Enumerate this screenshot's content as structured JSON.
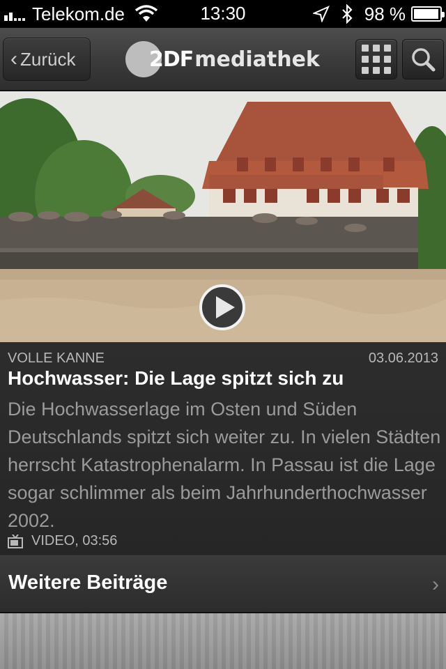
{
  "status_bar": {
    "carrier": "Telekom.de",
    "time": "13:30",
    "battery_percent": "98 %",
    "battery_level": 0.98
  },
  "nav": {
    "back_label": "Zurück",
    "logo_mark": "2DF",
    "logo_text": "mediathek",
    "icons": {
      "grid": "grid-icon",
      "search": "search-icon"
    }
  },
  "hero": {
    "icon": "play-icon"
  },
  "article": {
    "show_name": "VOLLE KANNE",
    "date": "03.06.2013",
    "headline": "Hochwasser: Die Lage spitzt sich zu",
    "summary": "Die Hochwasserlage im Osten und Süden Deutschlands spitzt sich weiter zu. In vielen Städten herrscht Katastrophenalarm. In Passau ist die Lage sogar schlimmer als beim Jahrhunderthochwasser 2002.",
    "video_meta": "VIDEO, 03:56"
  },
  "more": {
    "label": "Weitere Beiträge"
  }
}
